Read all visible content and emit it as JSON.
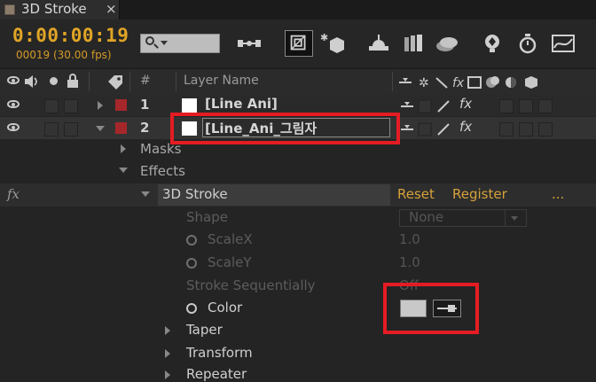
{
  "tab": {
    "title": "3D Stroke",
    "close": "×"
  },
  "toolbar": {
    "timecode": "0:00:00:19",
    "frames": "00019 (30.00 fps)"
  },
  "header": {
    "hash": "#",
    "layer_name": "Layer Name"
  },
  "layers": [
    {
      "num": "1",
      "name": "[Line Ani]"
    },
    {
      "num": "2",
      "name": "[Line_Ani_그림자"
    }
  ],
  "switch_col": {
    "fx": "fx"
  },
  "props": {
    "masks": "Masks",
    "effects": "Effects",
    "effect_name": "3D Stroke",
    "reset": "Reset",
    "register": "Register",
    "dots": "...",
    "shape": "Shape",
    "shape_value": "None",
    "scalex": "ScaleX",
    "scalex_value": "1.0",
    "scaley": "ScaleY",
    "scaley_value": "1.0",
    "stroke_seq": "Stroke Sequentially",
    "stroke_seq_value": "Off",
    "color": "Color",
    "taper": "Taper",
    "transform": "Transform",
    "repeater": "Repeater"
  },
  "colors": {
    "accent": "#e0a526",
    "highlight": "#e51c23",
    "label_red": "#a5272a"
  }
}
